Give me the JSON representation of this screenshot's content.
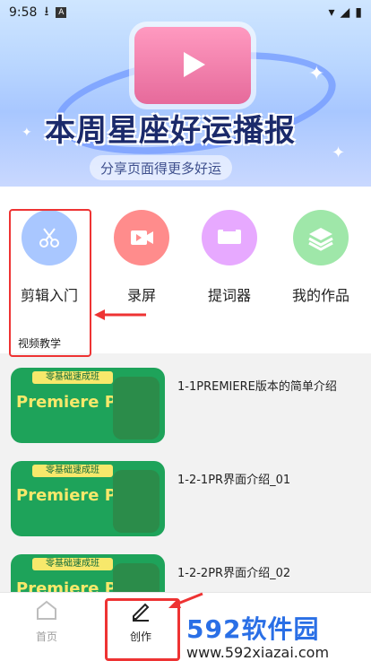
{
  "status": {
    "time": "9:58",
    "icons": [
      "download-icon",
      "a-badge-icon",
      "wifi-icon",
      "signal-icon",
      "battery-icon"
    ],
    "tag_letter": "A"
  },
  "banner": {
    "title": "本周星座好运播报",
    "subtitle": "分享页面得更多好运"
  },
  "menu": {
    "items": [
      {
        "label": "剪辑入门",
        "icon": "scissors-icon",
        "color": "#a9c7ff"
      },
      {
        "label": "录屏",
        "icon": "video-camera-icon",
        "color": "#ff8c8c"
      },
      {
        "label": "提词器",
        "icon": "monitor-icon",
        "color": "#e7a9ff"
      },
      {
        "label": "我的作品",
        "icon": "layers-icon",
        "color": "#9fe7a9"
      }
    ],
    "section_label": "视频教学"
  },
  "videos": [
    {
      "title": "1-1PREMIERE版本的简单介绍",
      "thumb_tag": "零基础速成班",
      "thumb_brand": "Premiere Pro."
    },
    {
      "title": "1-2-1PR界面介绍_01",
      "thumb_tag": "零基础速成班",
      "thumb_brand": "Premiere Pro."
    },
    {
      "title": "1-2-2PR界面介绍_02",
      "thumb_tag": "零基础速成班",
      "thumb_brand": "Premiere Pro."
    }
  ],
  "tabs": {
    "home": {
      "label": "首页",
      "icon": "home-icon"
    },
    "create": {
      "label": "创作",
      "icon": "pen-icon"
    }
  },
  "watermark": {
    "top": "592软件园",
    "bottom": "www.592xiazai.com"
  }
}
